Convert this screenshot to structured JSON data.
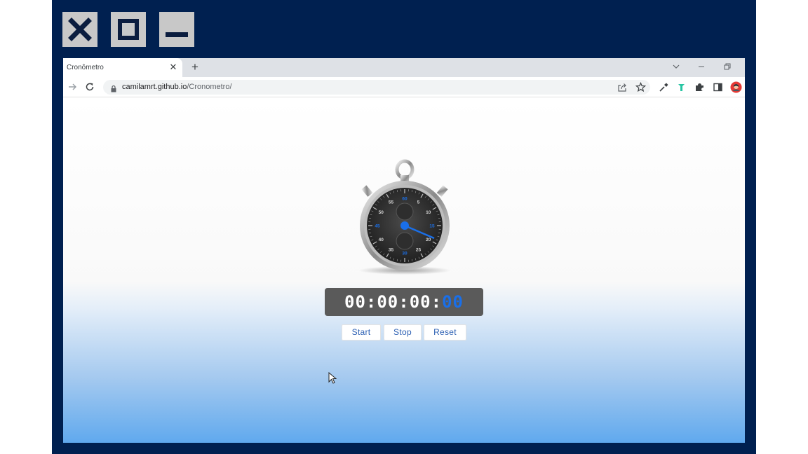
{
  "browser": {
    "tab_title": "Cronômetro",
    "tab_close": "✕",
    "new_tab": "+",
    "url_host": "camilamrt.github.io",
    "url_path": "/Cronometro/"
  },
  "stopwatch": {
    "hours": "00",
    "minutes": "00",
    "seconds": "00",
    "centiseconds": "00",
    "separator": ":",
    "dial_numbers": [
      "60",
      "5",
      "10",
      "15",
      "20",
      "25",
      "30",
      "35",
      "40",
      "45",
      "50",
      "55"
    ],
    "accent_color": "#1a6fe8"
  },
  "controls": {
    "start_label": "Start",
    "stop_label": "Stop",
    "reset_label": "Reset"
  },
  "icons": [
    "window-close-icon",
    "window-maximize-icon",
    "window-minimize-icon",
    "back-icon",
    "forward-icon",
    "reload-icon",
    "lock-icon",
    "share-icon",
    "bookmark-star-icon",
    "eyedropper-icon",
    "extension-icon",
    "puzzle-icon",
    "side-panel-icon",
    "profile-avatar-icon",
    "cursor-icon"
  ]
}
